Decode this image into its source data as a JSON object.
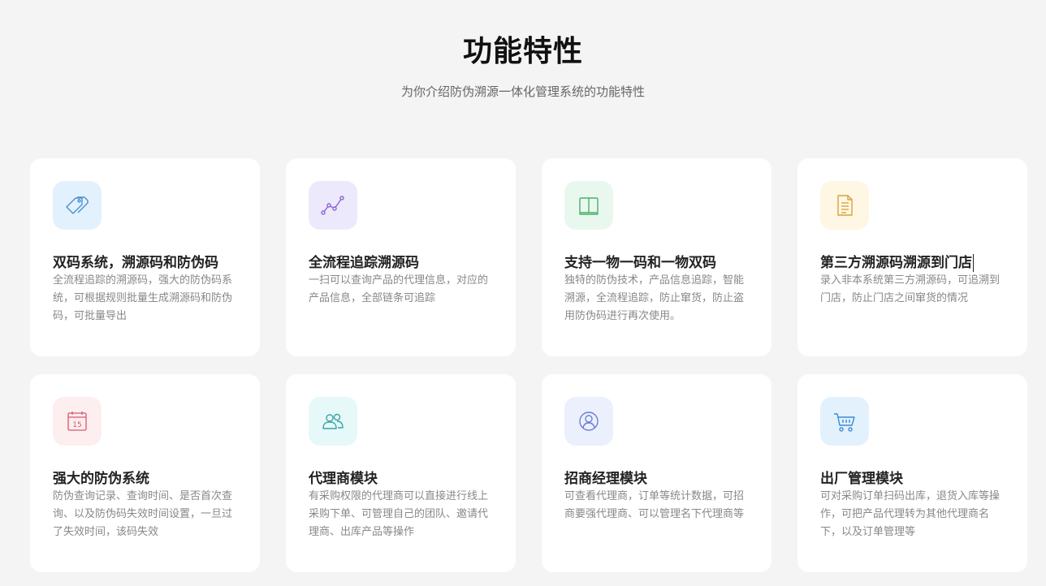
{
  "header": {
    "title": "功能特性",
    "subtitle": "为你介绍防伪溯源一体化管理系统的功能特性"
  },
  "cards": [
    {
      "icon": "tags-icon",
      "icon_bg": "#e3f1fd",
      "icon_color": "#4a8fd1",
      "title": "双码系统，溯源码和防伪码",
      "desc": "全流程追踪的溯源码，强大的防伪码系统，可根据规则批量生成溯源码和防伪码，可批量导出"
    },
    {
      "icon": "line-chart-icon",
      "icon_bg": "#ede9fd",
      "icon_color": "#8a63d2",
      "title": "全流程追踪溯源码",
      "desc": "一扫可以查询产品的代理信息，对应的产品信息，全部链条可追踪"
    },
    {
      "icon": "book-icon",
      "icon_bg": "#e9f8ee",
      "icon_color": "#4caf6a",
      "title": "支持一物一码和一物双码",
      "desc": "独特的防伪技术，产品信息追踪，智能溯源，全流程追踪，防止窜货，防止盗用防伪码进行再次使用。"
    },
    {
      "icon": "document-icon",
      "icon_bg": "#fdf7e3",
      "icon_color": "#d9a23d",
      "title": "第三方溯源码溯源到门店",
      "desc": "录入非本系统第三方溯源码，可追溯到门店，防止门店之间窜货的情况"
    },
    {
      "icon": "calendar-icon",
      "icon_bg": "#fdeef0",
      "icon_color": "#d9576a",
      "icon_text": "15",
      "title": "强大的防伪系统",
      "desc": "防伪查询记录、查询时间、是否首次查询、以及防伪码失效时间设置，一旦过了失效时间，该码失效"
    },
    {
      "icon": "users-icon",
      "icon_bg": "#e6f8f8",
      "icon_color": "#3aa6a8",
      "title": "代理商模块",
      "desc": "有采购权限的代理商可以直接进行线上采购下单、可管理自己的团队、邀请代理商、出库产品等操作"
    },
    {
      "icon": "user-circle-icon",
      "icon_bg": "#ecf0fc",
      "icon_color": "#6a7fd6",
      "title": "招商经理模块",
      "desc": "可查看代理商，订单等统计数据，可招商要强代理商、可以管理名下代理商等"
    },
    {
      "icon": "shopping-cart-icon",
      "icon_bg": "#e3f1fd",
      "icon_color": "#3a8ad6",
      "title": "出厂管理模块",
      "desc": "可对采购订单扫码出库，退货入库等操作，可把产品代理转为其他代理商名下，以及订单管理等"
    }
  ]
}
